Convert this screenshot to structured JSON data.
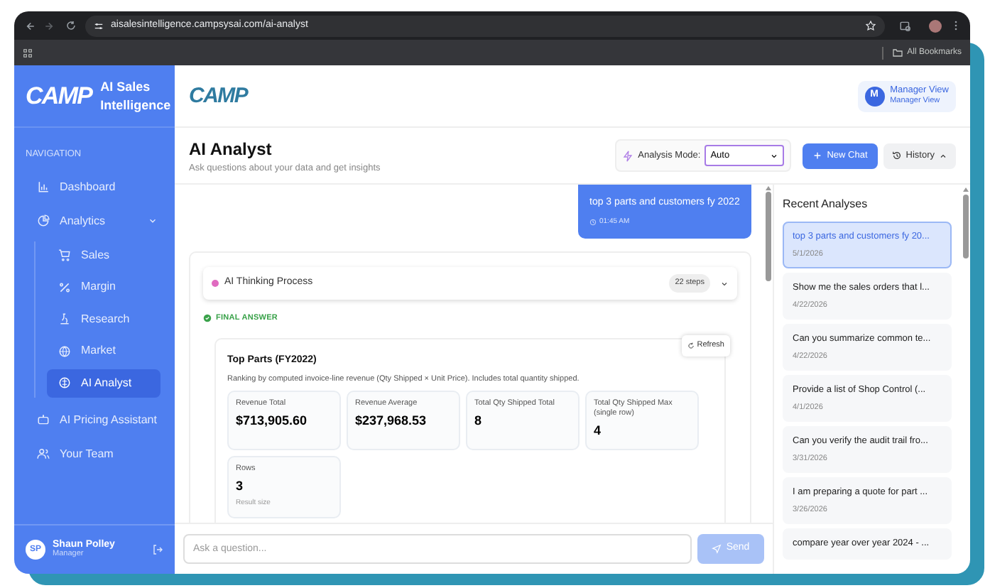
{
  "browser": {
    "url": "aisalesintelligence.campsysai.com/ai-analyst",
    "bookmarks": "All Bookmarks"
  },
  "sidebar": {
    "logo": "CAMP",
    "title": "AI Sales Intelligence",
    "section": "NAVIGATION",
    "items": [
      {
        "label": "Dashboard",
        "selected": false
      },
      {
        "label": "Analytics",
        "selected": false,
        "expanded": true,
        "children": [
          {
            "label": "Sales",
            "selected": false
          },
          {
            "label": "Margin",
            "selected": false
          },
          {
            "label": "Research",
            "selected": false
          },
          {
            "label": "Market",
            "selected": false
          },
          {
            "label": "AI Analyst",
            "selected": true
          }
        ]
      },
      {
        "label": "AI Pricing Assistant",
        "selected": false
      },
      {
        "label": "Your Team",
        "selected": false
      }
    ],
    "user": {
      "initials": "SP",
      "name": "Shaun Polley",
      "role": "Manager"
    }
  },
  "header": {
    "logo": "CAMP",
    "avatar": "M",
    "name": "Manager View",
    "role": "Manager View"
  },
  "page": {
    "title": "AI Analyst",
    "subtitle": "Ask questions about your data and get insights",
    "mode_label": "Analysis Mode:",
    "mode_value": "Auto",
    "new_chat": "New Chat",
    "history": "History"
  },
  "message": {
    "text": "top 3 parts and customers fy 2022",
    "time": "01:45 AM"
  },
  "answer": {
    "thinking": "AI Thinking Process",
    "steps": "22 steps",
    "status": "FINAL ANSWER",
    "card": {
      "title": "Top Parts (FY2022)",
      "description": "Ranking by computed invoice-line revenue (Qty Shipped × Unit Price). Includes total quantity shipped.",
      "refresh": "Refresh",
      "metrics": [
        {
          "label": "Revenue Total",
          "value": "$713,905.60"
        },
        {
          "label": "Revenue Average",
          "value": "$237,968.53"
        },
        {
          "label": "Total Qty Shipped Total",
          "value": "8"
        },
        {
          "label": "Total Qty Shipped Max (single row)",
          "value": "4"
        },
        {
          "label": "Rows",
          "value": "3",
          "note": "Result size"
        }
      ]
    }
  },
  "input": {
    "placeholder": "Ask a question...",
    "send": "Send"
  },
  "recent": {
    "title": "Recent Analyses",
    "items": [
      {
        "title": "top 3 parts and customers fy 20...",
        "date": "5/1/2026",
        "selected": true
      },
      {
        "title": "Show me the sales orders that l...",
        "date": "4/22/2026",
        "selected": false
      },
      {
        "title": "Can you summarize common te...",
        "date": "4/22/2026",
        "selected": false
      },
      {
        "title": "Provide a list of Shop Control (...",
        "date": "4/1/2026",
        "selected": false
      },
      {
        "title": "Can you verify the audit trail fro...",
        "date": "3/31/2026",
        "selected": false
      },
      {
        "title": "I am preparing a quote for part ...",
        "date": "3/26/2026",
        "selected": false
      },
      {
        "title": "compare year over year 2024 - ...",
        "selected": false
      }
    ]
  }
}
